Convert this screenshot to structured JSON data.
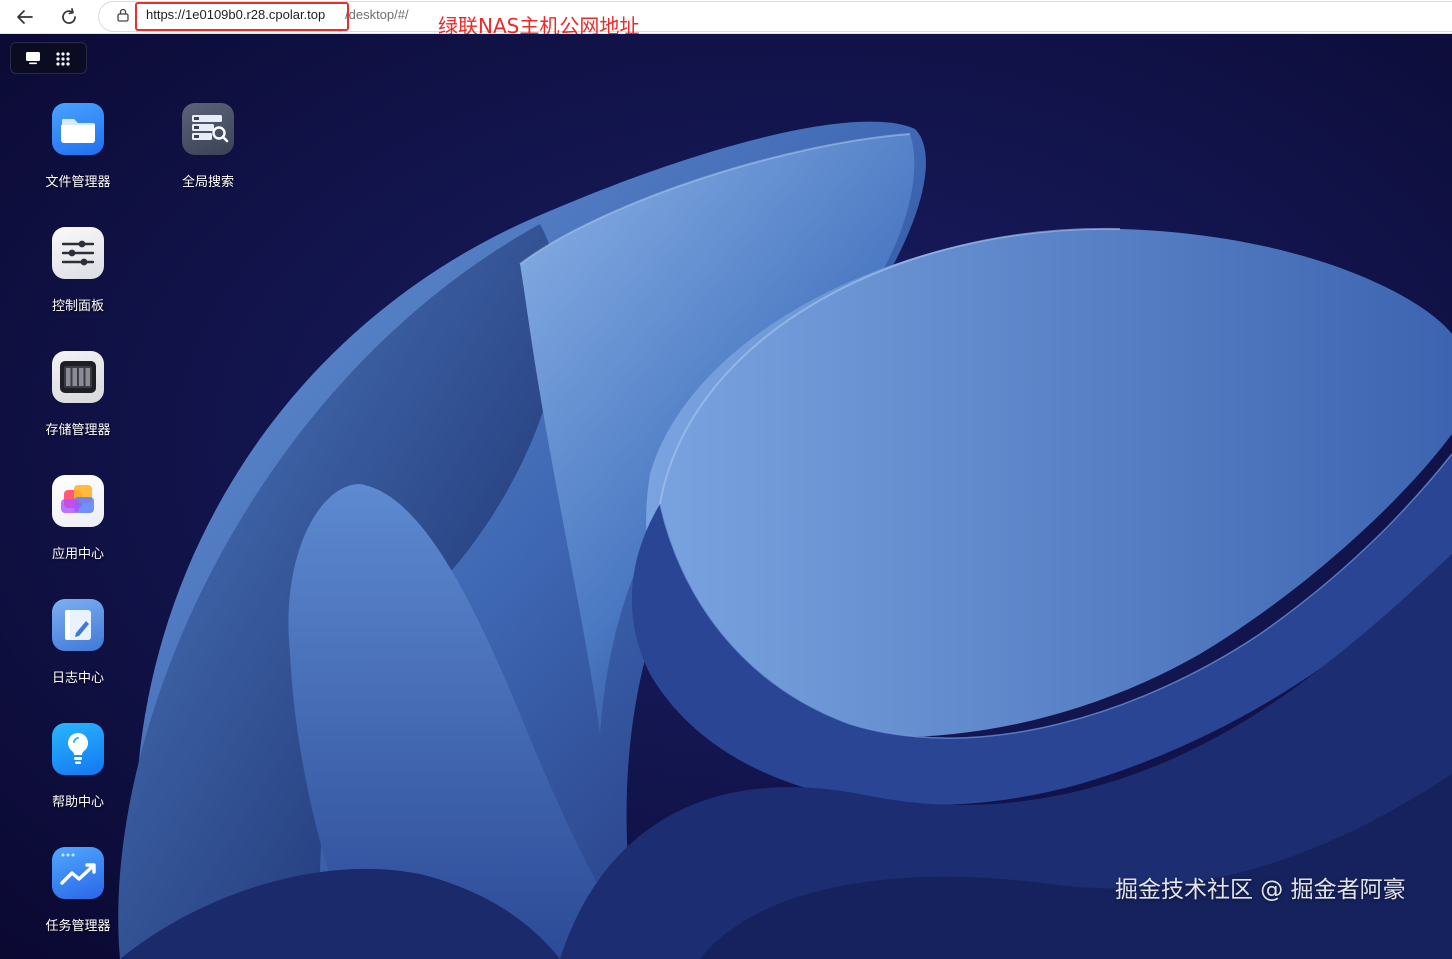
{
  "browser": {
    "url_host": "https://1e0109b0.r28.cpolar.top",
    "url_path": "/desktop/#/",
    "annotation": "绿联NAS主机公网地址"
  },
  "taskbar": {
    "icons": [
      "desktop-icon",
      "app-grid-icon"
    ]
  },
  "apps": [
    {
      "label": "文件管理器",
      "icon": "folder-icon"
    },
    {
      "label": "全局搜索",
      "icon": "global-search-icon"
    },
    {
      "label": "控制面板",
      "icon": "control-panel-icon"
    },
    {
      "label": "存储管理器",
      "icon": "storage-icon"
    },
    {
      "label": "应用中心",
      "icon": "app-center-icon"
    },
    {
      "label": "日志中心",
      "icon": "log-center-icon"
    },
    {
      "label": "帮助中心",
      "icon": "help-bulb-icon"
    },
    {
      "label": "任务管理器",
      "icon": "task-manager-icon"
    }
  ],
  "watermark": "掘金技术社区 @ 掘金者阿豪",
  "colors": {
    "desktop_bg": "#0d0a3a",
    "highlight_red": "#e53030",
    "annotation_red": "#ea2a2a"
  }
}
